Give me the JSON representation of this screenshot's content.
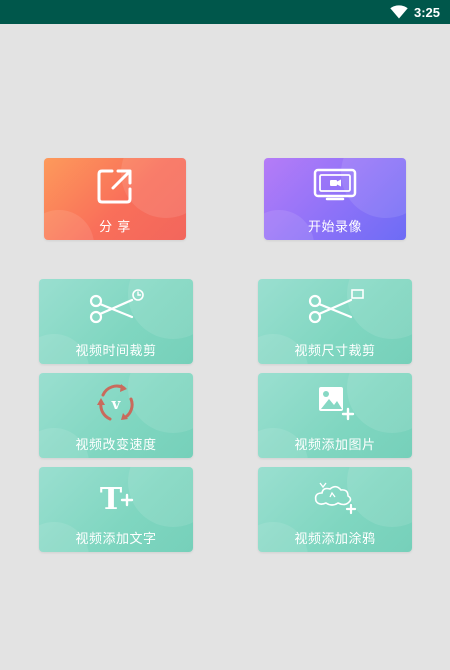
{
  "status_bar": {
    "time": "3:25",
    "wifi_icon": "wifi-icon"
  },
  "actions": {
    "share": {
      "label": "分 享",
      "icon": "share-external-icon",
      "color_start": "#fd9a5b",
      "color_end": "#f2665c"
    },
    "record": {
      "label": "开始录像",
      "icon": "video-record-icon",
      "color_start": "#b57cf7",
      "color_end": "#6d6cf5"
    }
  },
  "tools": [
    {
      "label": "视频时间裁剪",
      "icon": "scissors-clock-icon"
    },
    {
      "label": "视频尺寸裁剪",
      "icon": "scissors-frame-icon"
    },
    {
      "label": "视频改变速度",
      "icon": "speed-cycle-icon",
      "icon_letter": "v"
    },
    {
      "label": "视频添加图片",
      "icon": "add-image-icon"
    },
    {
      "label": "视频添加文字",
      "icon": "add-text-icon",
      "icon_letter": "T"
    },
    {
      "label": "视频添加涂鸦",
      "icon": "add-doodle-icon"
    }
  ],
  "colors": {
    "tool_card": "#86d8c4",
    "status_bar": "#00574b",
    "background": "#e3e3e3"
  }
}
